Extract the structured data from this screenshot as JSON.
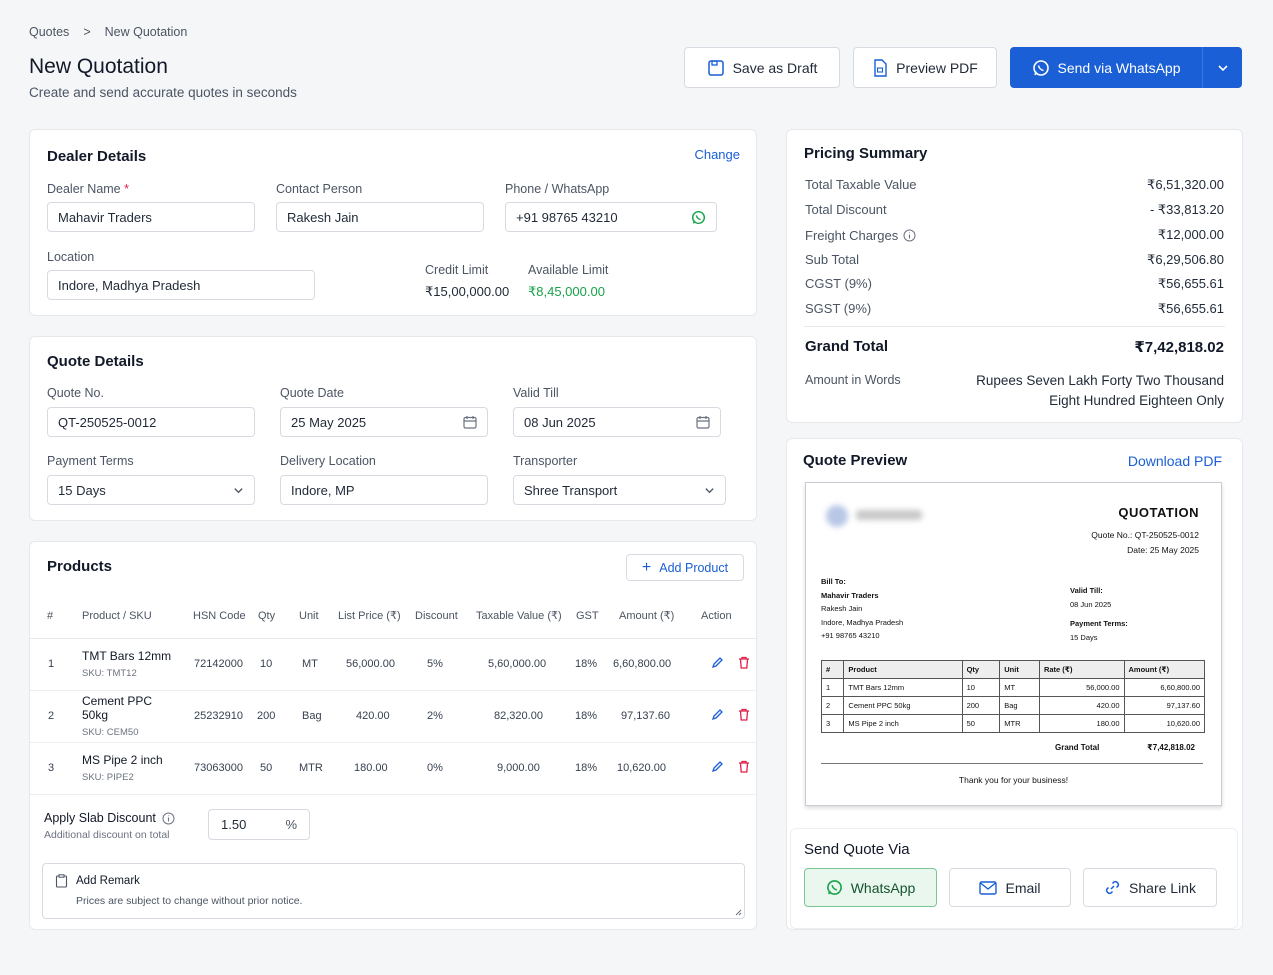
{
  "breadcrumb": {
    "root": "Quotes",
    "sep": ">",
    "current": "New Quotation"
  },
  "header": {
    "title": "New Quotation",
    "subtitle": "Create and send accurate quotes in seconds",
    "save_draft": "Save as Draft",
    "preview_pdf": "Preview PDF",
    "send_whatsapp": "Send via WhatsApp"
  },
  "dealer": {
    "title": "Dealer Details",
    "change": "Change",
    "name_label": "Dealer Name",
    "required_mark": "*",
    "name_value": "Mahavir Traders",
    "contact_label": "Contact Person",
    "contact_value": "Rakesh Jain",
    "phone_label": "Phone / WhatsApp",
    "phone_value": "+91 98765 43210",
    "location_label": "Location",
    "location_value": "Indore, Madhya Pradesh",
    "credit_label": "Credit Limit",
    "credit_value": "₹15,00,000.00",
    "available_label": "Available Limit",
    "available_value": "₹8,45,000.00"
  },
  "quote": {
    "title": "Quote Details",
    "no_label": "Quote No.",
    "no_value": "QT-250525-0012",
    "date_label": "Quote Date",
    "date_value": "25 May 2025",
    "valid_label": "Valid Till",
    "valid_value": "08 Jun 2025",
    "terms_label": "Payment Terms",
    "terms_value": "15 Days",
    "delivery_label": "Delivery Location",
    "delivery_value": "Indore, MP",
    "transporter_label": "Transporter",
    "transporter_value": "Shree Transport"
  },
  "products": {
    "title": "Products",
    "add": "Add Product",
    "headers": [
      "#",
      "Product / SKU",
      "HSN Code",
      "Qty",
      "Unit",
      "List Price (₹)",
      "Discount",
      "Taxable Value (₹)",
      "GST",
      "Amount (₹)",
      "Action"
    ],
    "rows": [
      {
        "n": "1",
        "name": "TMT Bars 12mm",
        "sku": "SKU: TMT12",
        "hsn": "72142000",
        "qty": "10",
        "unit": "MT",
        "price": "56,000.00",
        "disc": "5%",
        "taxable": "5,60,000.00",
        "gst": "18%",
        "amount": "6,60,800.00"
      },
      {
        "n": "2",
        "name": "Cement PPC 50kg",
        "sku": "SKU: CEM50",
        "hsn": "25232910",
        "qty": "200",
        "unit": "Bag",
        "price": "420.00",
        "disc": "2%",
        "taxable": "82,320.00",
        "gst": "18%",
        "amount": "97,137.60"
      },
      {
        "n": "3",
        "name": "MS Pipe 2 inch",
        "sku": "SKU: PIPE2",
        "hsn": "73063000",
        "qty": "50",
        "unit": "MTR",
        "price": "180.00",
        "disc": "0%",
        "taxable": "9,000.00",
        "gst": "18%",
        "amount": "10,620.00"
      }
    ],
    "slab_label": "Apply Slab Discount",
    "slab_sub": "Additional discount on total",
    "slab_value": "1.50",
    "slab_unit": "%",
    "remark_label": "Add Remark",
    "remark_text": "Prices are subject to change without prior notice."
  },
  "summary": {
    "title": "Pricing Summary",
    "rows": [
      {
        "k": "Total Taxable Value",
        "v": "₹6,51,320.00"
      },
      {
        "k": "Total Discount",
        "v": "- ₹33,813.20"
      },
      {
        "k": "Freight Charges",
        "v": "₹12,000.00"
      },
      {
        "k": "Sub Total",
        "v": "₹6,29,506.80"
      },
      {
        "k": "CGST (9%)",
        "v": "₹56,655.61"
      },
      {
        "k": "SGST (9%)",
        "v": "₹56,655.61"
      }
    ],
    "grand_label": "Grand Total",
    "grand_value": "₹7,42,818.02",
    "words_label": "Amount in Words",
    "words_line1": "Rupees Seven Lakh Forty Two Thousand",
    "words_line2": "Eight Hundred Eighteen Only"
  },
  "preview": {
    "title": "Quote Preview",
    "download": "Download PDF",
    "doc_title": "QUOTATION",
    "doc_no": "Quote No.: QT-250525-0012",
    "doc_date": "Date: 25 May 2025",
    "bill_to": "Bill To:",
    "bill_name": "Mahavir Traders",
    "bill_contact": "Rakesh Jain",
    "bill_loc": "Indore, Madhya Pradesh",
    "bill_phone": "+91 98765 43210",
    "valid_label": "Valid Till:",
    "valid_value": "08 Jun 2025",
    "terms_label": "Payment Terms:",
    "terms_value": "15 Days",
    "headers": [
      "#",
      "Product",
      "Qty",
      "Unit",
      "Rate (₹)",
      "Amount (₹)"
    ],
    "rows": [
      [
        "1",
        "TMT Bars 12mm",
        "10",
        "MT",
        "56,000.00",
        "6,60,800.00"
      ],
      [
        "2",
        "Cement PPC 50kg",
        "200",
        "Bag",
        "420.00",
        "97,137.60"
      ],
      [
        "3",
        "MS Pipe 2 inch",
        "50",
        "MTR",
        "180.00",
        "10,620.00"
      ]
    ],
    "grand_label": "Grand Total",
    "grand_value": "₹7,42,818.02",
    "thanks": "Thank you for your business!"
  },
  "send": {
    "title": "Send Quote Via",
    "whatsapp": "WhatsApp",
    "email": "Email",
    "share": "Share Link"
  },
  "colors": {
    "primary": "#1a5fd6",
    "success": "#16a34a",
    "danger": "#e11d48"
  }
}
